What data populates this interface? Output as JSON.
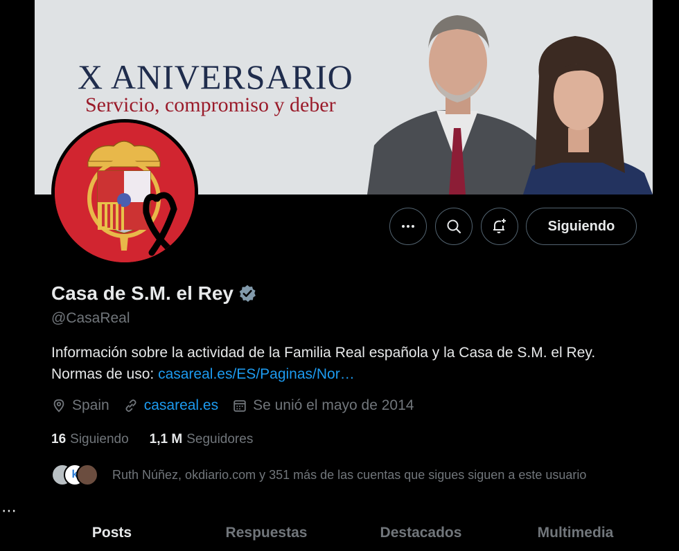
{
  "banner": {
    "title": "X ANIVERSARIO",
    "subtitle": "Servicio, compromiso y deber"
  },
  "actions": {
    "more_icon": "more-dots-icon",
    "search_icon": "search-icon",
    "notify_icon": "bell-plus-icon",
    "follow_label": "Siguiendo"
  },
  "profile": {
    "name": "Casa de S.M. el Rey",
    "handle": "@CasaReal",
    "bio_text": "Información sobre la actividad de la Familia Real española y la Casa de S.M. el Rey.",
    "bio_rules_label": "Normas de uso:",
    "bio_link": "casareal.es/ES/Paginas/Nor…",
    "location": "Spain",
    "website": "casareal.es",
    "joined": "Se unió el mayo de 2014",
    "following_count": "16",
    "following_label": "Siguiendo",
    "followers_count": "1,1 M",
    "followers_label": "Seguidores",
    "known_followers": "Ruth Núñez, okdiario.com y 351 más de las cuentas que sigues siguen a este usuario"
  },
  "tabs": [
    "Posts",
    "Respuestas",
    "Destacados",
    "Multimedia"
  ],
  "colors": {
    "accent": "#1d9bf0",
    "coat_red": "#d12530",
    "banner_bg": "#dfe2e4",
    "banner_title": "#1f2c4c",
    "banner_sub": "#9a1b2a"
  },
  "rail": {
    "dots": "⋯"
  }
}
